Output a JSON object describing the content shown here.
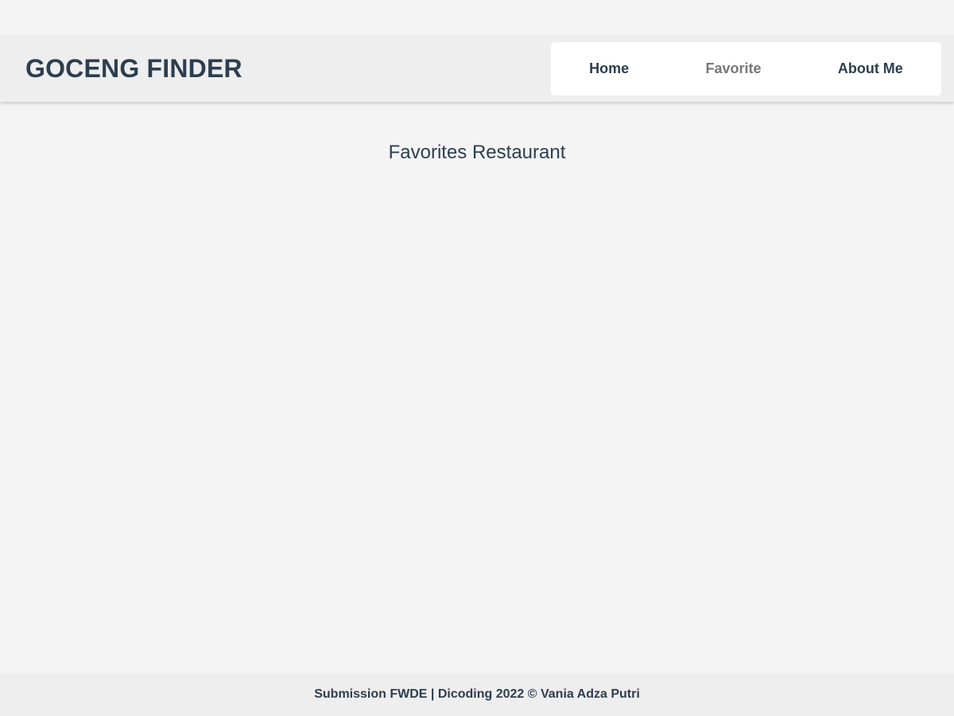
{
  "header": {
    "brand": "GOCENG FINDER"
  },
  "nav": {
    "items": [
      {
        "label": "Home"
      },
      {
        "label": "Favorite"
      },
      {
        "label": "About Me"
      }
    ],
    "active": "Favorite"
  },
  "main": {
    "title": "Favorites Restaurant"
  },
  "footer": {
    "text": "Submission FWDE | Dicoding 2022 © Vania Adza Putri"
  },
  "colors": {
    "background": "#f4f4f4",
    "header_background": "#eeeeee",
    "nav_background": "#ffffff",
    "text_primary": "#2c3e50",
    "nav_active": "#777777"
  }
}
